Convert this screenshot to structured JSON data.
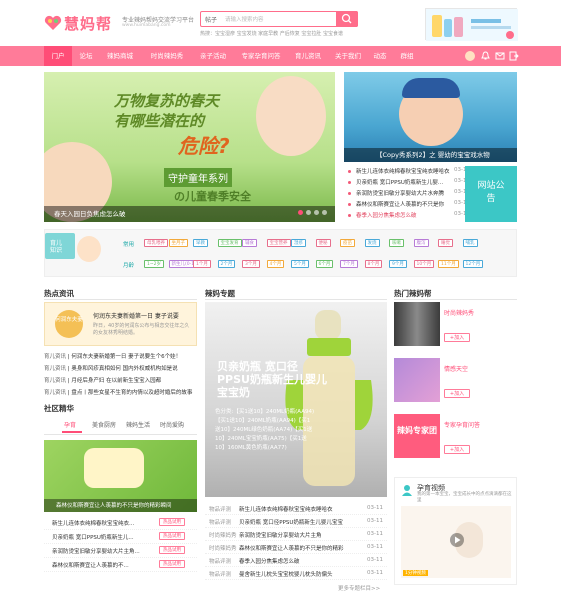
{
  "header": {
    "logo_text": "慧妈帮",
    "slogan": "专业辣妈帮妈交流学习平台",
    "url": "www.huimabang.com",
    "search_scope": "帖子",
    "search_placeholder": "请输入搜索内容",
    "hotwords": "热搜：宝宝湿疹  宝宝发烧  家庭早教  产后恢复  宝宝拉肚  宝宝食谱"
  },
  "nav": {
    "items": [
      "门户",
      "论坛",
      "辣妈商城",
      "时尚辣妈秀",
      "亲子活动",
      "专家孕育问答",
      "育儿资讯",
      "关于我们",
      "动态",
      "群组"
    ]
  },
  "banner": {
    "line1": "万物复苏的春天",
    "line2": "有哪些潜在的",
    "line3": "危险?",
    "line4": "守护童年系列",
    "line5": "の儿童春季安全",
    "caption": "春天入园日负焦虑怎么破"
  },
  "right_top": {
    "photo_caption": "【Copy秀系列2】之 婴幼的宝宝戏水物",
    "news": [
      {
        "text": "新生儿连体衣纯棉春秋宝宝纯衣睡哈衣",
        "date": "03-11"
      },
      {
        "text": "贝亲奶瓶 宽口PPSU奶瓶新生儿婴...",
        "date": "03-11"
      },
      {
        "text": "亲润防烫宝旧敏分享婴幼大片水奔腾",
        "date": "03-11"
      },
      {
        "text": "森林仪和斯赛宜让人羡慕的不只是你",
        "date": "03-11"
      },
      {
        "text": "春季入园分焦集虑怎么破",
        "date": "03-11"
      }
    ],
    "notice_label": "网站公告"
  },
  "tagbar": {
    "badge": "育儿知识",
    "row1_label": "常用",
    "row1": [
      "母乳喂养",
      "坐月子",
      "早教",
      "宝宝发育",
      "辅食",
      "宝宝营养",
      "湿疹",
      "便秘",
      "疫苗",
      "发烧",
      "咳嗽",
      "腹泻",
      "睡觉",
      "哺乳"
    ],
    "row2_label": "月龄",
    "row2": [
      "1~2岁",
      "新生儿(0-1月)",
      "1个月",
      "2个月",
      "3个月",
      "4个月",
      "5个月",
      "6个月",
      "7个月",
      "8个月",
      "9个月",
      "10个月",
      "11个月",
      "12个月"
    ]
  },
  "hot_news": {
    "title": "热点资讯",
    "box_circle": "何润东夫妻",
    "box_title": "何润东夫妻新婚第一日 妻子说要",
    "box_desc": "昨日，40岁的何润东公布与相恋交往年之久的女友林秀明结婚。",
    "items": [
      {
        "cat": "育儿资讯",
        "text": "何润东夫妻新婚第一日 妻子说要生个6个娃！"
      },
      {
        "cat": "育儿资讯",
        "text": "奥身和风疹真相如何 国内外权威机构如是说"
      },
      {
        "cat": "育儿资讯",
        "text": "月经后身产妇 在以前新生宝宝入园都"
      },
      {
        "cat": "育儿资讯",
        "text": "盘点丨那些女星不生育的内情以及超时婚后的故事"
      }
    ]
  },
  "community": {
    "title": "社区精华",
    "tabs": [
      "孕育",
      "美食厨房",
      "辣妈生活",
      "时尚爱购"
    ],
    "photo_caption": "森林仪和斯赛宜让人羡慕的不只是你的精彩瞬间",
    "items": [
      {
        "text": "新生儿连体衣纯棉春秋宝宝纯衣...",
        "tag": "热品试用"
      },
      {
        "text": "贝亲奶瓶 宽口PPSU奶瓶新生儿...",
        "tag": "热品试用"
      },
      {
        "text": "亲润防烫宝旧敏分享婴幼大片主角...",
        "tag": "热品试用"
      },
      {
        "text": "森林仪和斯赛宜让人羡慕的不...",
        "tag": "热品试用"
      }
    ]
  },
  "topic": {
    "title": "辣妈专题",
    "bottle_title": "贝亲奶瓶 宽口径PPSU奶瓶新生儿婴儿宝宝奶",
    "bottle_detail": "色分类:【买1送10】240ML奶瓶(AA94) 【买1送10】240ML奶瓶(AA94)【买1送10】240ML绿色奶瓶(AA74)【买1送10】240ML宝宝奶瓶(AA75)【买1送10】160ML黄色奶瓶(AA77)",
    "items": [
      {
        "cat": "物品评测",
        "text": "新生儿连体衣纯棉春秋宝宝纯衣睡哈衣",
        "date": "03-11"
      },
      {
        "cat": "物品评测",
        "text": "贝亲奶瓶 宽口径PPSU奶瓶新生儿婴儿宝宝",
        "date": "03-11"
      },
      {
        "cat": "时尚辣妈秀",
        "text": "亲润防烫宝旧敏分享婴幼大片主角",
        "date": "03-11"
      },
      {
        "cat": "时尚辣妈秀",
        "text": "森林仪和斯赛宜让人羡慕的不只是你的精彩",
        "date": "03-11"
      },
      {
        "cat": "物品评测",
        "text": "春季入园分焦集虑怎么破",
        "date": "03-11"
      },
      {
        "cat": "物品评测",
        "text": "曼舍新生儿枕头宝宝枕婴儿枕头防偏头",
        "date": "03-11"
      }
    ],
    "more": "更多专题栏目>>"
  },
  "hot_moms": {
    "title": "热门辣妈帮",
    "groups": [
      {
        "name": "时尚辣妈秀",
        "join": "加入"
      },
      {
        "name": "情感天空",
        "join": "加入"
      },
      {
        "name": "专家孕育问答",
        "join": "加入",
        "banner": "辣妈专家团"
      }
    ]
  },
  "video": {
    "title": "孕育视频",
    "desc": "我的第一本宝宝，宝宝成长中的点点滴滴都在这里",
    "tag": "1分钟视频"
  }
}
